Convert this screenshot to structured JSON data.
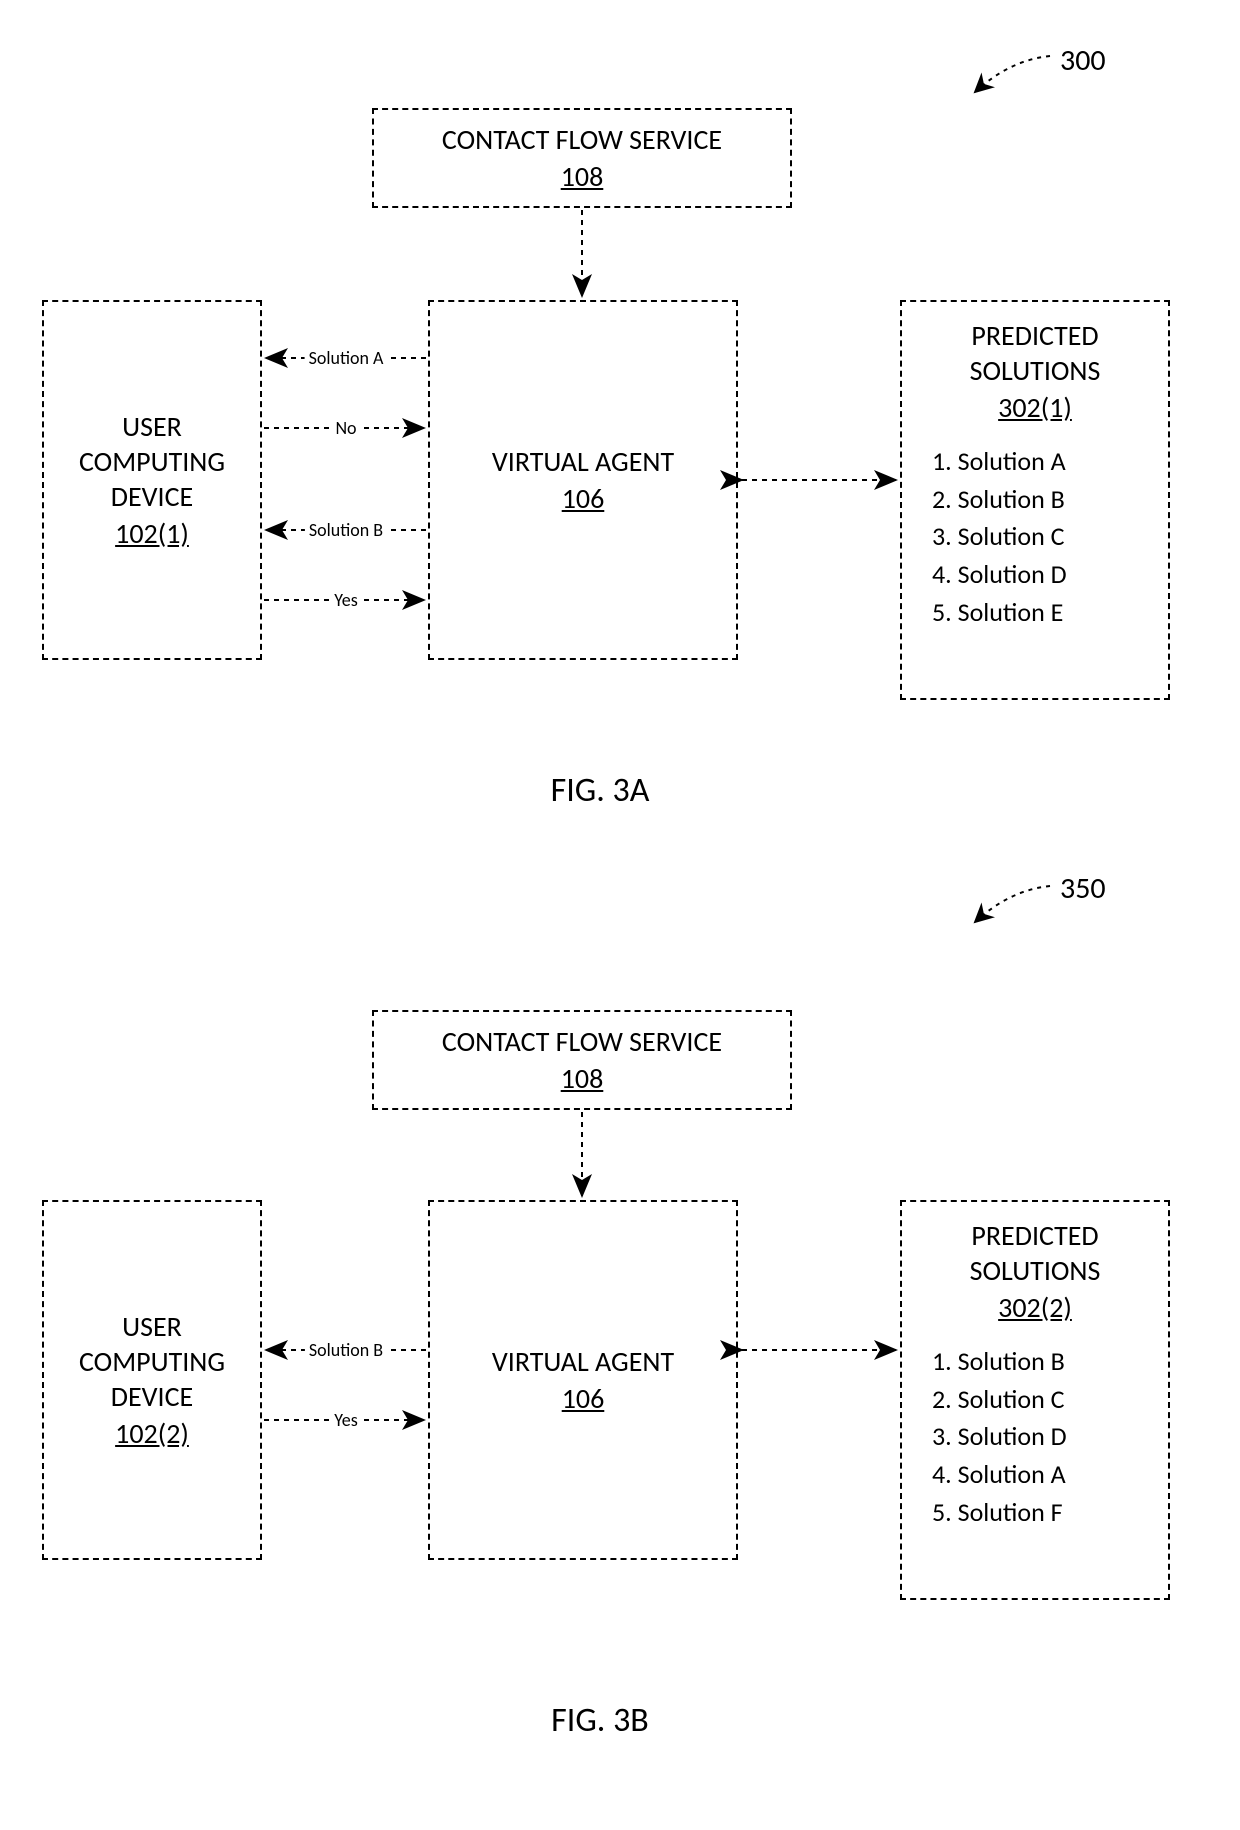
{
  "figA": {
    "refnum": "300",
    "label": "FIG. 3A",
    "contactFlow": {
      "title": "CONTACT FLOW SERVICE",
      "ref": "108"
    },
    "virtualAgent": {
      "title": "VIRTUAL AGENT",
      "ref": "106"
    },
    "userDevice": {
      "title1": "USER",
      "title2": "COMPUTING",
      "title3": "DEVICE",
      "ref": "102(1)"
    },
    "predicted": {
      "title1": "PREDICTED",
      "title2": "SOLUTIONS",
      "ref": "302(1)",
      "items": {
        "i1": "1. Solution A",
        "i2": "2. Solution B",
        "i3": "3. Solution C",
        "i4": "4. Solution D",
        "i5": "5. Solution E"
      }
    },
    "edges": {
      "e1": "Solution A",
      "e2": "No",
      "e3": "Solution B",
      "e4": "Yes"
    }
  },
  "figB": {
    "refnum": "350",
    "label": "FIG. 3B",
    "contactFlow": {
      "title": "CONTACT FLOW SERVICE",
      "ref": "108"
    },
    "virtualAgent": {
      "title": "VIRTUAL AGENT",
      "ref": "106"
    },
    "userDevice": {
      "title1": "USER",
      "title2": "COMPUTING",
      "title3": "DEVICE",
      "ref": "102(2)"
    },
    "predicted": {
      "title1": "PREDICTED",
      "title2": "SOLUTIONS",
      "ref": "302(2)",
      "items": {
        "i1": "1. Solution B",
        "i2": "2. Solution C",
        "i3": "3. Solution D",
        "i4": "4. Solution A",
        "i5": "5. Solution F"
      }
    },
    "edges": {
      "e1": "Solution B",
      "e2": "Yes"
    }
  }
}
